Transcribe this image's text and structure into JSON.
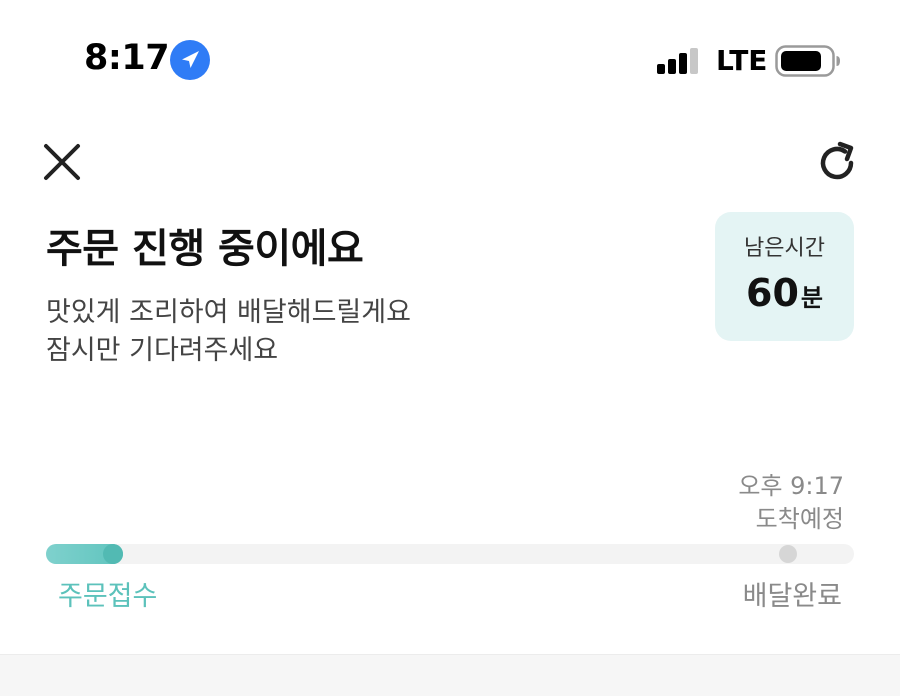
{
  "status_bar": {
    "time": "8:17",
    "network": "LTE",
    "location_icon": "location-arrow-icon",
    "signal_icon": "cellular-signal-icon",
    "battery_icon": "battery-icon"
  },
  "nav": {
    "close_icon": "close-icon",
    "refresh_icon": "refresh-icon"
  },
  "order": {
    "title": "주문 진행 중이에요",
    "subtitle_line1": "맛있게 조리하여 배달해드릴게요",
    "subtitle_line2": "잠시만 기다려주세요"
  },
  "remaining": {
    "label": "남은시간",
    "value": "60",
    "unit": "분"
  },
  "eta": {
    "time": "오후 9:17",
    "label": "도착예정"
  },
  "progress": {
    "fraction": 0.095,
    "start_label": "주문접수",
    "end_label": "배달완료"
  },
  "colors": {
    "accent": "#5cc2bb",
    "card_bg": "#e4f4f4",
    "location_blue": "#2f7cf6"
  }
}
